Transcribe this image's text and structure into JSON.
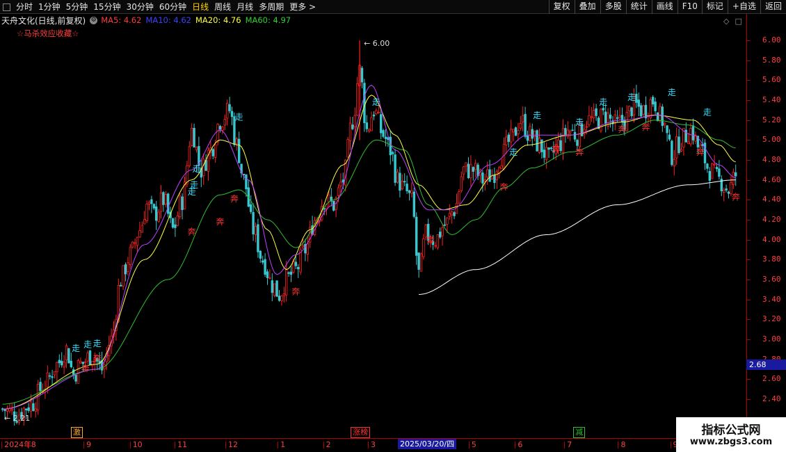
{
  "toolbar": {
    "periods": [
      "分时",
      "1分钟",
      "5分钟",
      "15分钟",
      "30分钟",
      "60分钟",
      "日线",
      "周线",
      "月线",
      "多周期",
      "更多 >"
    ],
    "active": "日线",
    "buttons": [
      "复权",
      "叠加",
      "多股",
      "统计",
      "画线",
      "F10",
      "标记",
      "+自选",
      "返回"
    ]
  },
  "info": {
    "stock": "天舟文化(日线,前复权)",
    "ma5": "MA5: 4.62",
    "ma10": "MA10: 4.62",
    "ma20": "MA20: 4.76",
    "ma60": "MA60: 4.97",
    "sublabel": "☆马杀效应收藏☆",
    "corner_icons": [
      "◇",
      "□"
    ]
  },
  "colors": {
    "up": "#ff2020",
    "down": "#36c8d0",
    "ma5": "#ffffff",
    "ma10": "#c040ff",
    "ma20": "#ffff40",
    "ma60": "#30c030",
    "long_ma": "#ffffff",
    "axis": "#ff4040",
    "signal_walk": "#36e0ff",
    "signal_run": "#ff3030"
  },
  "price_axis": {
    "ticks": [
      "6.00",
      "5.80",
      "5.60",
      "5.40",
      "5.20",
      "5.00",
      "4.80",
      "4.60",
      "4.40",
      "4.20",
      "4.00",
      "3.80",
      "3.60",
      "3.40",
      "3.20",
      "3.00",
      "2.80",
      "2.60",
      "2.40"
    ],
    "current": "2.68"
  },
  "chart_data": {
    "type": "candlestick",
    "ylim": [
      2.21,
      6.1
    ],
    "high_label": "6.00",
    "low_label": "2.21",
    "anchors": [
      [
        0,
        2.3
      ],
      [
        6,
        2.25
      ],
      [
        12,
        2.35
      ],
      [
        18,
        2.55
      ],
      [
        23,
        2.75
      ],
      [
        27,
        2.9
      ],
      [
        30,
        2.65
      ],
      [
        33,
        2.75
      ],
      [
        38,
        2.85
      ],
      [
        42,
        2.7
      ],
      [
        46,
        3.0
      ],
      [
        50,
        3.6
      ],
      [
        54,
        3.85
      ],
      [
        58,
        4.1
      ],
      [
        61,
        4.35
      ],
      [
        64,
        4.25
      ],
      [
        68,
        4.4
      ],
      [
        72,
        4.1
      ],
      [
        76,
        4.4
      ],
      [
        80,
        5.1
      ],
      [
        84,
        4.7
      ],
      [
        88,
        4.9
      ],
      [
        92,
        5.2
      ],
      [
        96,
        5.3
      ],
      [
        99,
        4.95
      ],
      [
        102,
        4.6
      ],
      [
        106,
        4.1
      ],
      [
        110,
        3.8
      ],
      [
        114,
        3.55
      ],
      [
        117,
        3.45
      ],
      [
        120,
        3.6
      ],
      [
        124,
        3.7
      ],
      [
        128,
        3.9
      ],
      [
        132,
        4.2
      ],
      [
        136,
        4.4
      ],
      [
        140,
        4.35
      ],
      [
        144,
        4.6
      ],
      [
        148,
        5.2
      ],
      [
        151,
        5.7
      ],
      [
        154,
        5.1
      ],
      [
        157,
        5.3
      ],
      [
        161,
        5.05
      ],
      [
        164,
        4.9
      ],
      [
        167,
        4.6
      ],
      [
        170,
        4.5
      ],
      [
        173,
        4.4
      ],
      [
        176,
        3.65
      ],
      [
        179,
        4.05
      ],
      [
        183,
        4.0
      ],
      [
        187,
        4.15
      ],
      [
        191,
        4.3
      ],
      [
        195,
        4.7
      ],
      [
        199,
        4.7
      ],
      [
        203,
        4.6
      ],
      [
        207,
        4.65
      ],
      [
        211,
        4.85
      ],
      [
        215,
        5.0
      ],
      [
        219,
        5.2
      ],
      [
        223,
        5.05
      ],
      [
        227,
        4.95
      ],
      [
        231,
        4.8
      ],
      [
        235,
        4.95
      ],
      [
        239,
        5.1
      ],
      [
        243,
        5.05
      ],
      [
        247,
        5.2
      ],
      [
        251,
        5.2
      ],
      [
        255,
        5.25
      ],
      [
        259,
        5.15
      ],
      [
        263,
        5.2
      ],
      [
        267,
        5.35
      ],
      [
        271,
        5.3
      ],
      [
        275,
        5.4
      ],
      [
        279,
        5.2
      ],
      [
        283,
        4.85
      ],
      [
        287,
        5.0
      ],
      [
        291,
        5.1
      ],
      [
        295,
        4.9
      ],
      [
        299,
        4.7
      ],
      [
        303,
        4.6
      ],
      [
        307,
        4.5
      ],
      [
        310,
        4.65
      ]
    ],
    "ma_curves": {
      "ma60": [
        [
          0,
          2.35
        ],
        [
          40,
          2.7
        ],
        [
          70,
          3.6
        ],
        [
          92,
          4.45
        ],
        [
          100,
          4.5
        ],
        [
          112,
          4.2
        ],
        [
          124,
          3.92
        ],
        [
          140,
          4.4
        ],
        [
          158,
          5.0
        ],
        [
          170,
          4.9
        ],
        [
          180,
          4.35
        ],
        [
          190,
          4.05
        ],
        [
          200,
          4.2
        ],
        [
          212,
          4.52
        ],
        [
          224,
          4.72
        ],
        [
          240,
          4.88
        ],
        [
          260,
          5.05
        ],
        [
          276,
          5.2
        ],
        [
          290,
          5.15
        ],
        [
          303,
          5.0
        ],
        [
          310,
          4.92
        ]
      ],
      "ma20": [
        [
          0,
          2.3
        ],
        [
          40,
          2.75
        ],
        [
          60,
          3.8
        ],
        [
          80,
          4.6
        ],
        [
          92,
          5.0
        ],
        [
          100,
          4.95
        ],
        [
          112,
          4.1
        ],
        [
          120,
          3.7
        ],
        [
          130,
          4.1
        ],
        [
          144,
          4.75
        ],
        [
          156,
          5.45
        ],
        [
          166,
          5.05
        ],
        [
          176,
          4.55
        ],
        [
          186,
          4.3
        ],
        [
          196,
          4.35
        ],
        [
          208,
          4.65
        ],
        [
          222,
          4.95
        ],
        [
          240,
          5.05
        ],
        [
          262,
          5.18
        ],
        [
          276,
          5.25
        ],
        [
          292,
          5.2
        ],
        [
          303,
          4.95
        ],
        [
          310,
          4.78
        ]
      ],
      "ma10": [
        [
          0,
          2.3
        ],
        [
          40,
          2.7
        ],
        [
          60,
          3.95
        ],
        [
          80,
          4.7
        ],
        [
          92,
          5.1
        ],
        [
          104,
          4.6
        ],
        [
          116,
          3.65
        ],
        [
          124,
          3.85
        ],
        [
          140,
          4.35
        ],
        [
          156,
          5.55
        ],
        [
          166,
          4.9
        ],
        [
          180,
          4.3
        ],
        [
          190,
          4.3
        ],
        [
          206,
          4.75
        ],
        [
          222,
          5.05
        ],
        [
          240,
          5.05
        ],
        [
          262,
          5.2
        ],
        [
          278,
          5.25
        ],
        [
          292,
          5.05
        ],
        [
          303,
          4.75
        ],
        [
          310,
          4.62
        ]
      ]
    },
    "long_ma": [
      [
        176,
        3.45
      ],
      [
        200,
        3.7
      ],
      [
        230,
        4.05
      ],
      [
        260,
        4.35
      ],
      [
        290,
        4.55
      ],
      [
        310,
        4.6
      ]
    ],
    "signals_walk": [
      [
        31,
        2.88
      ],
      [
        36,
        2.92
      ],
      [
        40,
        2.93
      ],
      [
        80,
        4.45
      ],
      [
        82,
        4.68
      ],
      [
        81,
        4.52
      ],
      [
        100,
        5.2
      ],
      [
        158,
        5.35
      ],
      [
        216,
        4.85
      ],
      [
        226,
        5.22
      ],
      [
        244,
        5.15
      ],
      [
        254,
        5.35
      ],
      [
        266,
        5.4
      ],
      [
        283,
        5.45
      ],
      [
        298,
        5.25
      ]
    ],
    "signals_run": [
      [
        35,
        2.68
      ],
      [
        40,
        2.78
      ],
      [
        80,
        4.05
      ],
      [
        92,
        4.15
      ],
      [
        98,
        4.38
      ],
      [
        124,
        3.45
      ],
      [
        181,
        3.97
      ],
      [
        212,
        4.5
      ],
      [
        234,
        4.88
      ],
      [
        244,
        4.85
      ],
      [
        262,
        5.08
      ],
      [
        272,
        5.1
      ],
      [
        295,
        4.85
      ],
      [
        310,
        4.4
      ]
    ],
    "walk_char": "走",
    "run_char": "奔"
  },
  "bottom_markers": [
    {
      "text": "激",
      "color": "#ffaa30",
      "pos": 0.095
    },
    {
      "text": "涨榜",
      "color": "#ff3030",
      "pos": 0.47
    },
    {
      "text": "减",
      "color": "#30c030",
      "pos": 0.768
    }
  ],
  "date_axis": {
    "labels": [
      {
        "text": "2024年",
        "pos": 0.002
      },
      {
        "text": "8",
        "pos": 0.038
      },
      {
        "text": "9",
        "pos": 0.112
      },
      {
        "text": "10",
        "pos": 0.174
      },
      {
        "text": "11",
        "pos": 0.234
      },
      {
        "text": "12",
        "pos": 0.302
      },
      {
        "text": "1",
        "pos": 0.372
      },
      {
        "text": "2",
        "pos": 0.433
      },
      {
        "text": "3",
        "pos": 0.493
      },
      {
        "text": "5",
        "pos": 0.628
      },
      {
        "text": "6",
        "pos": 0.69
      },
      {
        "text": "7",
        "pos": 0.756
      },
      {
        "text": "8",
        "pos": 0.828
      },
      {
        "text": "9",
        "pos": 0.898
      }
    ],
    "cursor": "2025/03/20/四"
  },
  "watermark": {
    "line1": "指标公式网",
    "line2": "www.zbgs3.com"
  }
}
